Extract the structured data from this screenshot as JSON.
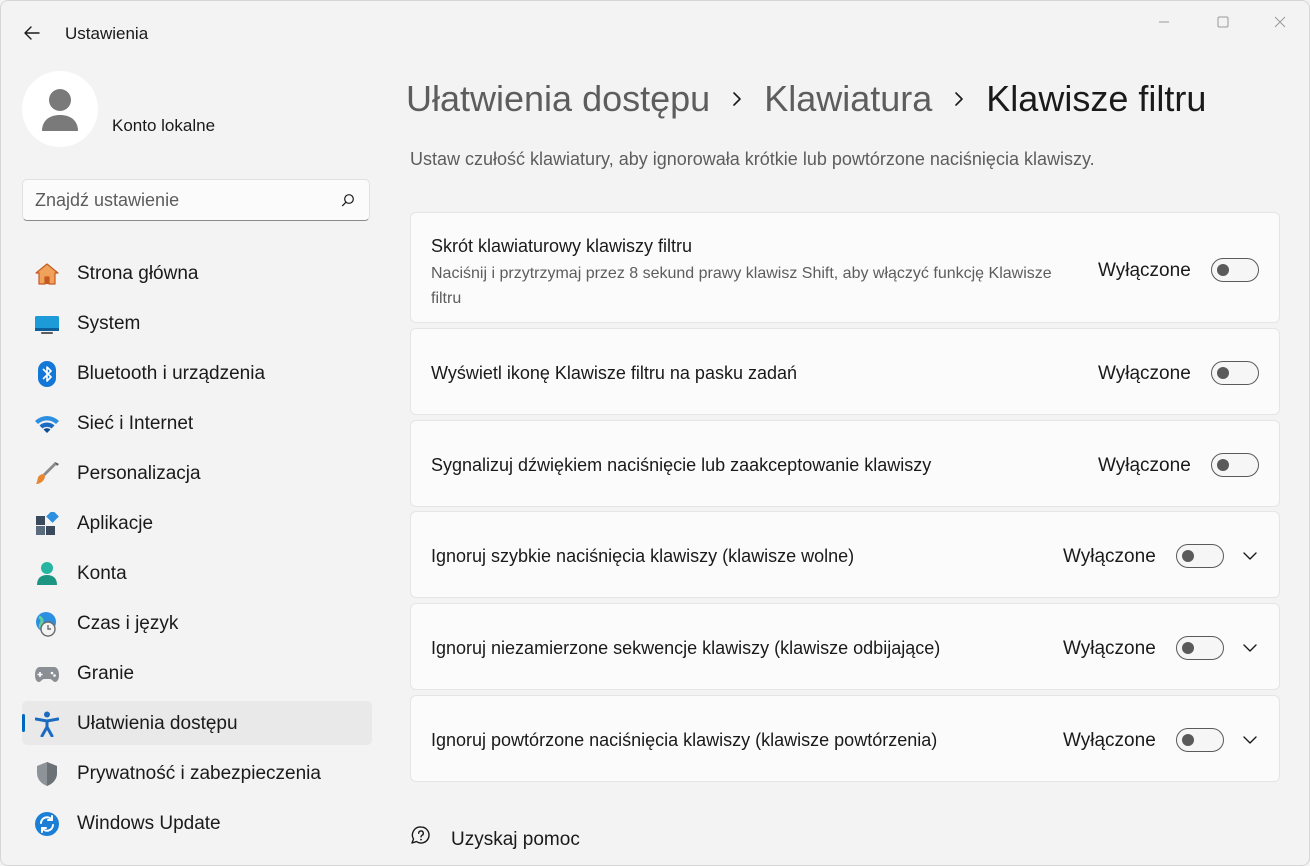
{
  "window": {
    "title": "Ustawienia"
  },
  "profile": {
    "name": "Konto lokalne"
  },
  "search": {
    "placeholder": "Znajdź ustawienie"
  },
  "sidebar": {
    "items": [
      {
        "label": "Strona główna",
        "icon": "home-icon"
      },
      {
        "label": "System",
        "icon": "system-icon"
      },
      {
        "label": "Bluetooth i urządzenia",
        "icon": "bluetooth-icon"
      },
      {
        "label": "Sieć i Internet",
        "icon": "wifi-icon"
      },
      {
        "label": "Personalizacja",
        "icon": "brush-icon"
      },
      {
        "label": "Aplikacje",
        "icon": "apps-icon"
      },
      {
        "label": "Konta",
        "icon": "account-icon"
      },
      {
        "label": "Czas i język",
        "icon": "globe-clock-icon"
      },
      {
        "label": "Granie",
        "icon": "gamepad-icon"
      },
      {
        "label": "Ułatwienia dostępu",
        "icon": "accessibility-icon",
        "active": true
      },
      {
        "label": "Prywatność i zabezpieczenia",
        "icon": "shield-icon"
      },
      {
        "label": "Windows Update",
        "icon": "update-icon"
      }
    ]
  },
  "breadcrumb": {
    "level1": "Ułatwienia dostępu",
    "level2": "Klawiatura",
    "current": "Klawisze filtru"
  },
  "description": "Ustaw czułość klawiatury, aby ignorowała krótkie lub powtórzone naciśnięcia klawiszy.",
  "settings": [
    {
      "title": "Skrót klawiaturowy klawiszy filtru",
      "subtitle": "Naciśnij i przytrzymaj przez 8 sekund prawy klawisz Shift, aby włączyć funkcję Klawisze filtru",
      "state": "Wyłączone",
      "on": false,
      "expandable": false
    },
    {
      "title": "Wyświetl ikonę Klawisze filtru na pasku zadań",
      "state": "Wyłączone",
      "on": false,
      "expandable": false
    },
    {
      "title": "Sygnalizuj dźwiękiem naciśnięcie lub zaakceptowanie klawiszy",
      "state": "Wyłączone",
      "on": false,
      "expandable": false
    },
    {
      "title": "Ignoruj szybkie naciśnięcia klawiszy (klawisze wolne)",
      "state": "Wyłączone",
      "on": false,
      "expandable": true
    },
    {
      "title": "Ignoruj niezamierzone sekwencje klawiszy (klawisze odbijające)",
      "state": "Wyłączone",
      "on": false,
      "expandable": true
    },
    {
      "title": "Ignoruj powtórzone naciśnięcia klawiszy (klawisze powtórzenia)",
      "state": "Wyłączone",
      "on": false,
      "expandable": true
    }
  ],
  "help": {
    "label": "Uzyskaj pomoc"
  },
  "colors": {
    "accent": "#0067c0",
    "background": "#f3f3f3",
    "card": "#fbfbfb"
  }
}
